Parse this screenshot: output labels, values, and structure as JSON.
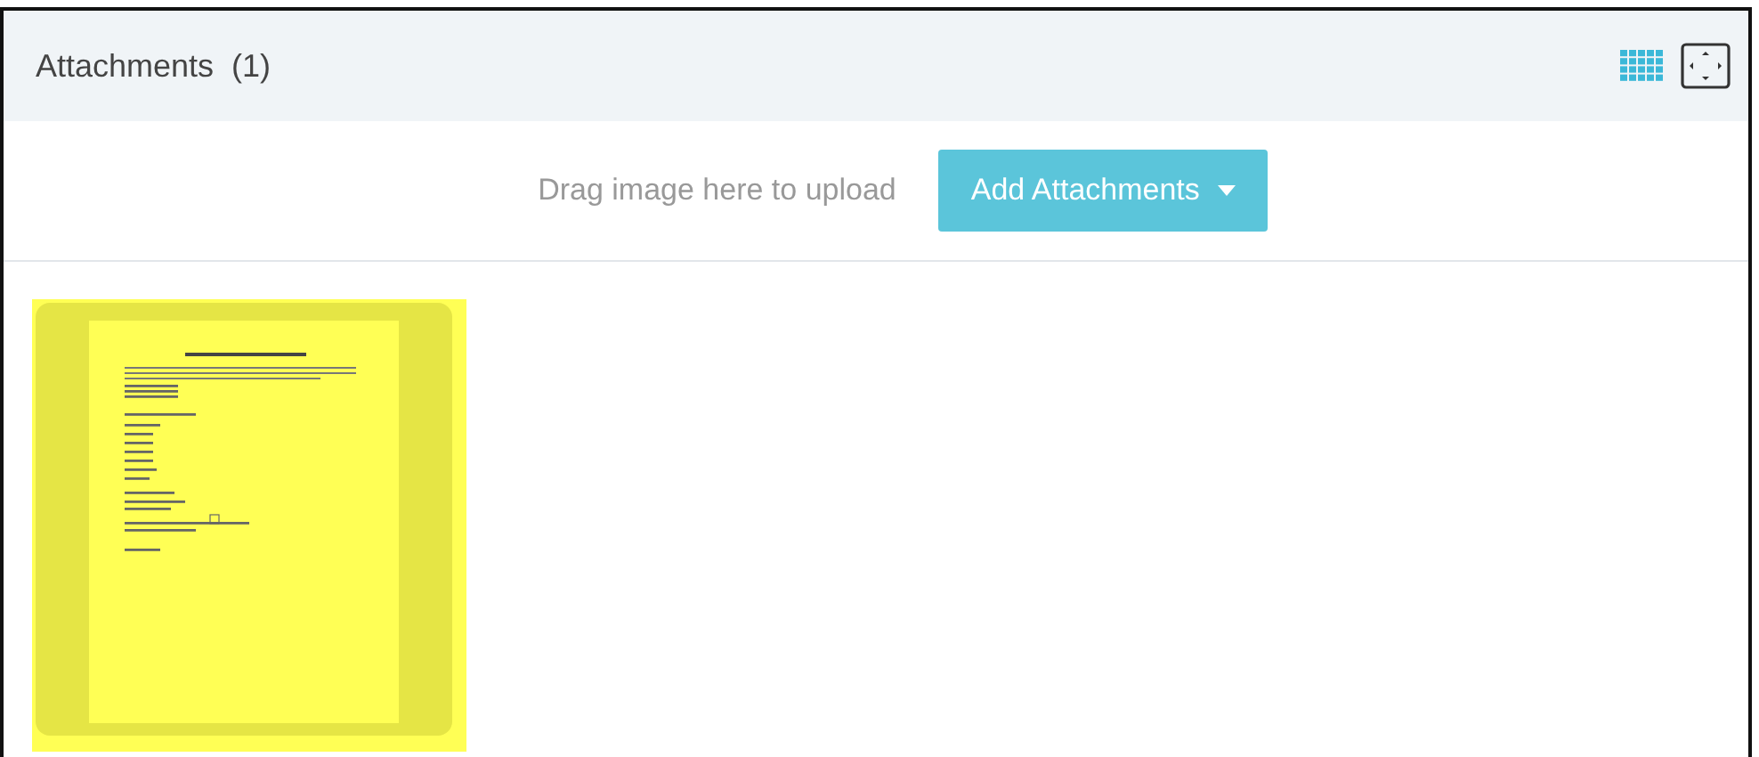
{
  "panel": {
    "title": "Attachments",
    "count": "(1)"
  },
  "upload": {
    "hint": "Drag image here to upload",
    "button": "Add Attachments"
  },
  "attachments": [
    {
      "kind": "document"
    }
  ]
}
